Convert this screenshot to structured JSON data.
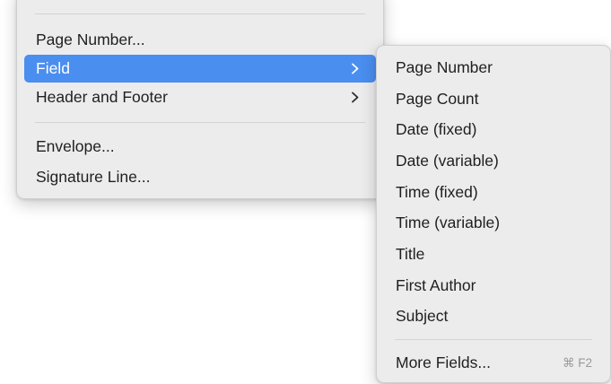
{
  "main_menu": {
    "items": [
      {
        "label": "Page Number..."
      },
      {
        "label": "Field"
      },
      {
        "label": "Header and Footer"
      },
      {
        "label": "Envelope..."
      },
      {
        "label": "Signature Line..."
      }
    ]
  },
  "sub_menu": {
    "items": [
      {
        "label": "Page Number"
      },
      {
        "label": "Page Count"
      },
      {
        "label": "Date (fixed)"
      },
      {
        "label": "Date (variable)"
      },
      {
        "label": "Time (fixed)"
      },
      {
        "label": "Time (variable)"
      },
      {
        "label": "Title"
      },
      {
        "label": "First Author"
      },
      {
        "label": "Subject"
      },
      {
        "label": "More Fields...",
        "shortcut": "⌘ F2"
      }
    ]
  },
  "colors": {
    "highlight": "#4a8ef0",
    "menu_bg": "#ececec",
    "text": "#1f1f1f",
    "shortcut_text": "#9a9a9a"
  },
  "icons": {
    "submenu_arrow": "chevron-right-icon"
  }
}
